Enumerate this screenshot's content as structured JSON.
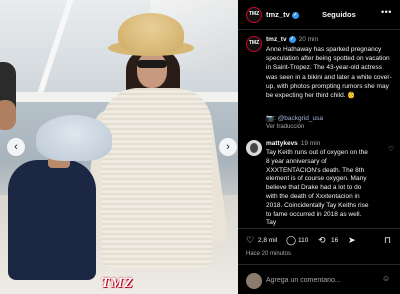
{
  "header": {
    "username": "tmz_tv",
    "follow_label": "Seguidos",
    "more_glyph": "•••",
    "avatar_text": "TMZ"
  },
  "caption": {
    "username": "tmz_tv",
    "time": "20 min",
    "text": "Anne Hathaway has sparked pregnancy speculation after being spotted on vacation in Saint-Tropez. The 43-year-old actress was seen in a bikini and later a white cover-up, with photos prompting rumors she may be expecting her third child. 👶",
    "credit": "📷: @backgrid_usa",
    "translation_label": "Ver traducción"
  },
  "comment": {
    "username": "mattykevs",
    "time": "19 min",
    "text": "Tay Keith runs out of oxygen on the 8 year anniversary of XXXTENTACION's death. The 8th element is of course oxygen. Many believe that Drake had a lot to do with the death of Xxxtentacion in 2018. Coincidentally Tay Keiths rise to fame occurred in 2018 as well. Tay"
  },
  "actions": {
    "likes": "2,8 mil",
    "comments": "110",
    "shares": "16"
  },
  "posted_ago": "Hace 20 minutos",
  "comment_box": {
    "placeholder": "Agrega un comentario..."
  },
  "photo": {
    "watermark": "TMZ"
  },
  "icons": {
    "heart": "♡",
    "comment": "◯",
    "repost": "⟲",
    "share": "➤",
    "bookmark": "⊓",
    "emoji": "☺",
    "prev": "‹",
    "next": "›",
    "verified": "✓"
  }
}
